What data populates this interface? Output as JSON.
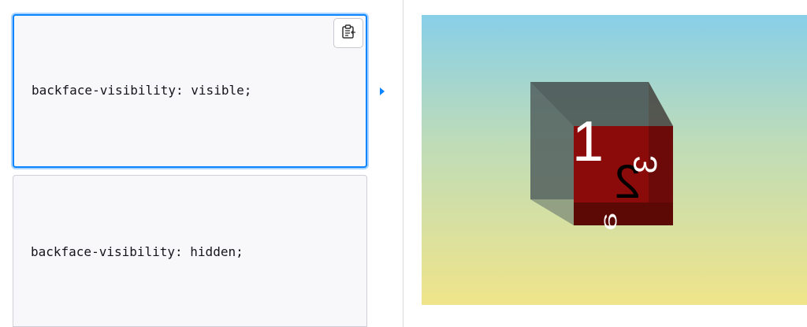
{
  "editor": {
    "options": [
      {
        "code": "backface-visibility: visible;",
        "selected": true
      },
      {
        "code": "backface-visibility: hidden;",
        "selected": false
      }
    ],
    "copy_icon": "clipboard-icon"
  },
  "output": {
    "gradient_colors": [
      "#88cfe8",
      "#f0e48a"
    ],
    "cube_faces": {
      "front": "1",
      "back": "2",
      "right": "3",
      "bottom": "6"
    },
    "face_color": "#8b0a0a"
  }
}
